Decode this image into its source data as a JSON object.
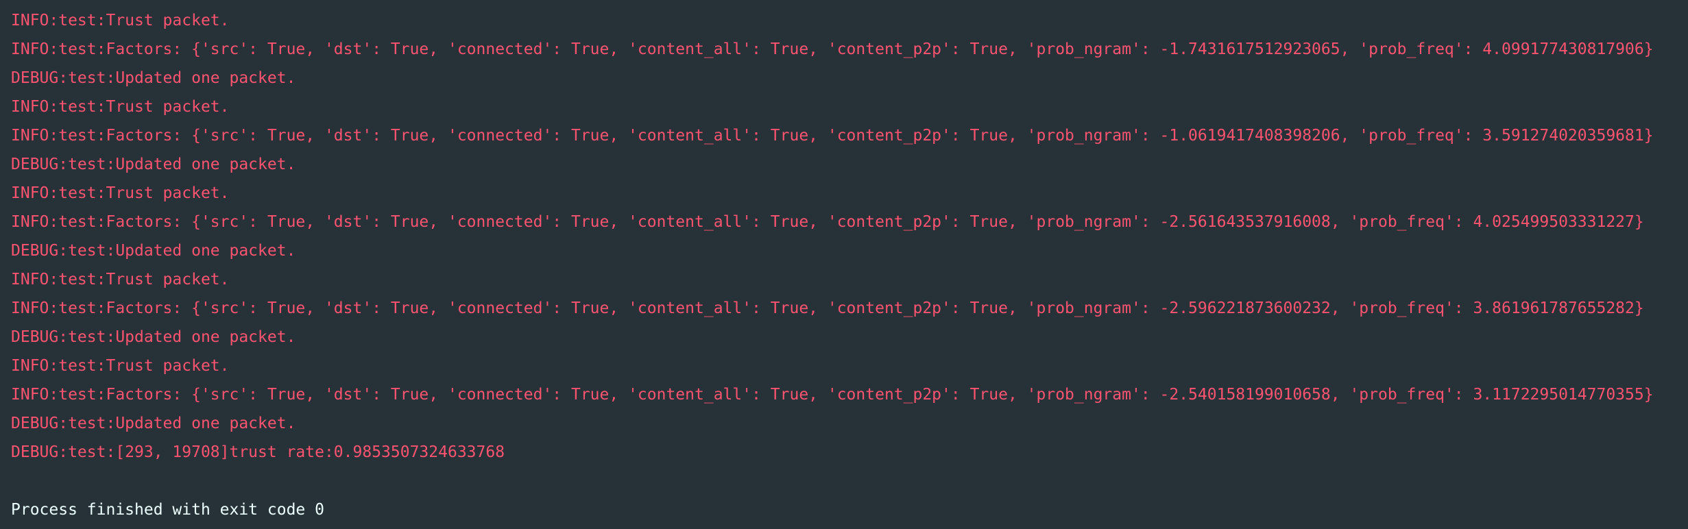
{
  "console": {
    "log_color": "#ff5370",
    "process_color": "#eeffff",
    "background": "#263238",
    "lines": [
      "INFO:test:Trust packet.",
      "INFO:test:Factors: {'src': True, 'dst': True, 'connected': True, 'content_all': True, 'content_p2p': True, 'prob_ngram': -1.7431617512923065, 'prob_freq': 4.099177430817906}",
      "DEBUG:test:Updated one packet.",
      "INFO:test:Trust packet.",
      "INFO:test:Factors: {'src': True, 'dst': True, 'connected': True, 'content_all': True, 'content_p2p': True, 'prob_ngram': -1.0619417408398206, 'prob_freq': 3.591274020359681}",
      "DEBUG:test:Updated one packet.",
      "INFO:test:Trust packet.",
      "INFO:test:Factors: {'src': True, 'dst': True, 'connected': True, 'content_all': True, 'content_p2p': True, 'prob_ngram': -2.561643537916008, 'prob_freq': 4.025499503331227}",
      "DEBUG:test:Updated one packet.",
      "INFO:test:Trust packet.",
      "INFO:test:Factors: {'src': True, 'dst': True, 'connected': True, 'content_all': True, 'content_p2p': True, 'prob_ngram': -2.596221873600232, 'prob_freq': 3.861961787655282}",
      "DEBUG:test:Updated one packet.",
      "INFO:test:Trust packet.",
      "INFO:test:Factors: {'src': True, 'dst': True, 'connected': True, 'content_all': True, 'content_p2p': True, 'prob_ngram': -2.540158199010658, 'prob_freq': 3.1172295014770355}",
      "DEBUG:test:Updated one packet.",
      "DEBUG:test:[293, 19708]trust rate:0.9853507324633768"
    ],
    "process_message": "Process finished with exit code 0"
  }
}
